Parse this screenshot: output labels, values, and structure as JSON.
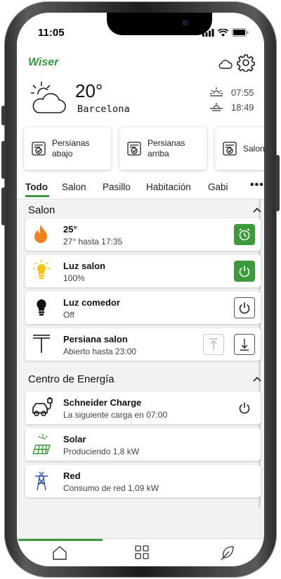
{
  "status": {
    "time": "11:05"
  },
  "app": {
    "logo": "Wiser"
  },
  "weather": {
    "temperature": "20°",
    "city": "Barcelona",
    "sunrise": "07:55",
    "sunset": "18:49",
    "icon": "sun-behind-cloud-icon"
  },
  "scenes": [
    {
      "label": "Persianas\nabajo"
    },
    {
      "label": "Persianas\narriba"
    },
    {
      "label": "Salon"
    }
  ],
  "tabs": [
    "Todo",
    "Salon",
    "Pasillo",
    "Habitación",
    "Gabi"
  ],
  "tabs_active_index": 0,
  "sections": {
    "salon": {
      "title": "Salon",
      "devices": [
        {
          "title": "25°",
          "subtitle": "27° hasta 17:35",
          "icon": "flame-icon",
          "action": "timer-icon"
        },
        {
          "title": "Luz salon",
          "subtitle": "100%",
          "icon": "bulb-on-icon",
          "action": "power-icon"
        },
        {
          "title": "Luz comedor",
          "subtitle": "Off",
          "icon": "bulb-off-icon",
          "action": "power-icon"
        },
        {
          "title": "Persiana salon",
          "subtitle": "Abierto hasta 23:00",
          "icon": "blind-icon",
          "actions": [
            "arrow-up-icon",
            "arrow-down-icon"
          ]
        }
      ]
    },
    "energy": {
      "title": "Centro de Energía",
      "devices": [
        {
          "title": "Schneider Charge",
          "subtitle": "La siguiente carga en 07:00",
          "icon": "ev-charger-icon",
          "action": "power-icon"
        },
        {
          "title": "Solar",
          "subtitle": "Produciendo 1,8 kW",
          "icon": "solar-panel-icon"
        },
        {
          "title": "Red",
          "subtitle": "Consumo de red 1,09 kW",
          "icon": "power-tower-icon"
        }
      ]
    }
  },
  "colors": {
    "accent": "#3c9a3c",
    "flame": "#f0821e",
    "bulb": "#f4c21a"
  },
  "bottom_nav": [
    "home-icon",
    "grid-icon",
    "leaf-icon"
  ]
}
